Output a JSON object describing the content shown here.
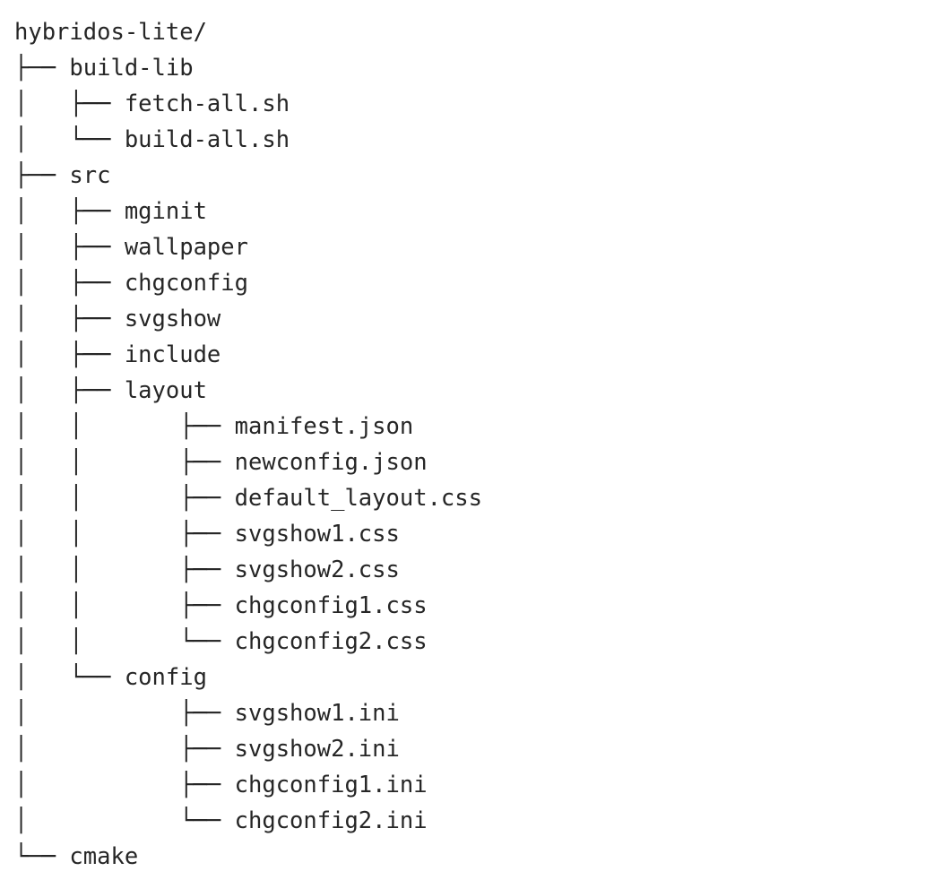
{
  "terminal": {
    "background_color": "#ffffff",
    "text_color": "#262626",
    "root_label": "hybridos-lite/",
    "tree_lines": [
      "hybridos-lite/",
      "├── build-lib",
      "│   ├── fetch-all.sh",
      "│   └── build-all.sh",
      "├── src",
      "│   ├── mginit",
      "│   ├── wallpaper",
      "│   ├── chgconfig",
      "│   ├── svgshow",
      "│   ├── include",
      "│   ├── layout",
      "│   │       ├── manifest.json",
      "│   │       ├── newconfig.json",
      "│   │       ├── default_layout.css",
      "│   │       ├── svgshow1.css",
      "│   │       ├── svgshow2.css",
      "│   │       ├── chgconfig1.css",
      "│   │       └── chgconfig2.css",
      "│   └── config",
      "│           ├── svgshow1.ini",
      "│           ├── svgshow2.ini",
      "│           ├── chgconfig1.ini",
      "│           └── chgconfig2.ini",
      "└── cmake"
    ],
    "entries": [
      {
        "name": "hybridos-lite/",
        "type": "directory",
        "depth": 0
      },
      {
        "name": "build-lib",
        "type": "directory",
        "depth": 1
      },
      {
        "name": "fetch-all.sh",
        "type": "file",
        "depth": 2
      },
      {
        "name": "build-all.sh",
        "type": "file",
        "depth": 2
      },
      {
        "name": "src",
        "type": "directory",
        "depth": 1
      },
      {
        "name": "mginit",
        "type": "directory",
        "depth": 2
      },
      {
        "name": "wallpaper",
        "type": "directory",
        "depth": 2
      },
      {
        "name": "chgconfig",
        "type": "directory",
        "depth": 2
      },
      {
        "name": "svgshow",
        "type": "directory",
        "depth": 2
      },
      {
        "name": "include",
        "type": "directory",
        "depth": 2
      },
      {
        "name": "layout",
        "type": "directory",
        "depth": 2
      },
      {
        "name": "manifest.json",
        "type": "file",
        "depth": 3
      },
      {
        "name": "newconfig.json",
        "type": "file",
        "depth": 3
      },
      {
        "name": "default_layout.css",
        "type": "file",
        "depth": 3
      },
      {
        "name": "svgshow1.css",
        "type": "file",
        "depth": 3
      },
      {
        "name": "svgshow2.css",
        "type": "file",
        "depth": 3
      },
      {
        "name": "chgconfig1.css",
        "type": "file",
        "depth": 3
      },
      {
        "name": "chgconfig2.css",
        "type": "file",
        "depth": 3
      },
      {
        "name": "config",
        "type": "directory",
        "depth": 2
      },
      {
        "name": "svgshow1.ini",
        "type": "file",
        "depth": 3
      },
      {
        "name": "svgshow2.ini",
        "type": "file",
        "depth": 3
      },
      {
        "name": "chgconfig1.ini",
        "type": "file",
        "depth": 3
      },
      {
        "name": "chgconfig2.ini",
        "type": "file",
        "depth": 3
      },
      {
        "name": "cmake",
        "type": "directory",
        "depth": 1
      }
    ]
  }
}
